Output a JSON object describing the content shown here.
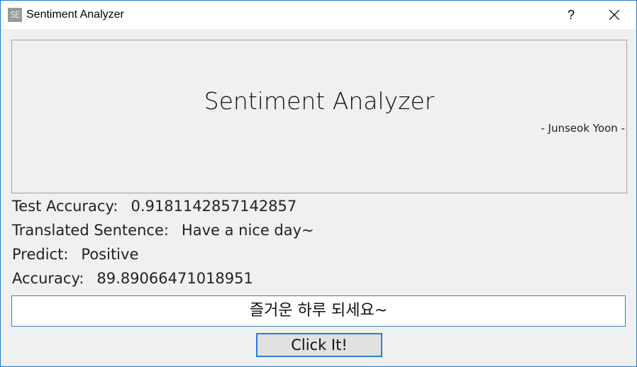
{
  "window": {
    "title": "Sentiment Analyzer",
    "icon_text": "SE",
    "help_label": "?"
  },
  "header": {
    "title": "Sentiment Analyzer",
    "author": "- Junseok Yoon -"
  },
  "results": {
    "test_accuracy_label": "Test Accuracy:",
    "test_accuracy_value": "0.9181142857142857",
    "translated_label": "Translated Sentence:",
    "translated_value": "Have a nice day~",
    "predict_label": "Predict:",
    "predict_value": "Positive",
    "accuracy_label": "Accuracy:",
    "accuracy_value": "89.89066471018951"
  },
  "input": {
    "value": "즐거운 하루 되세요~"
  },
  "actions": {
    "click_label": "Click It!"
  },
  "colors": {
    "accent": "#2b7fd4",
    "window_bg": "#f0f0f0"
  }
}
